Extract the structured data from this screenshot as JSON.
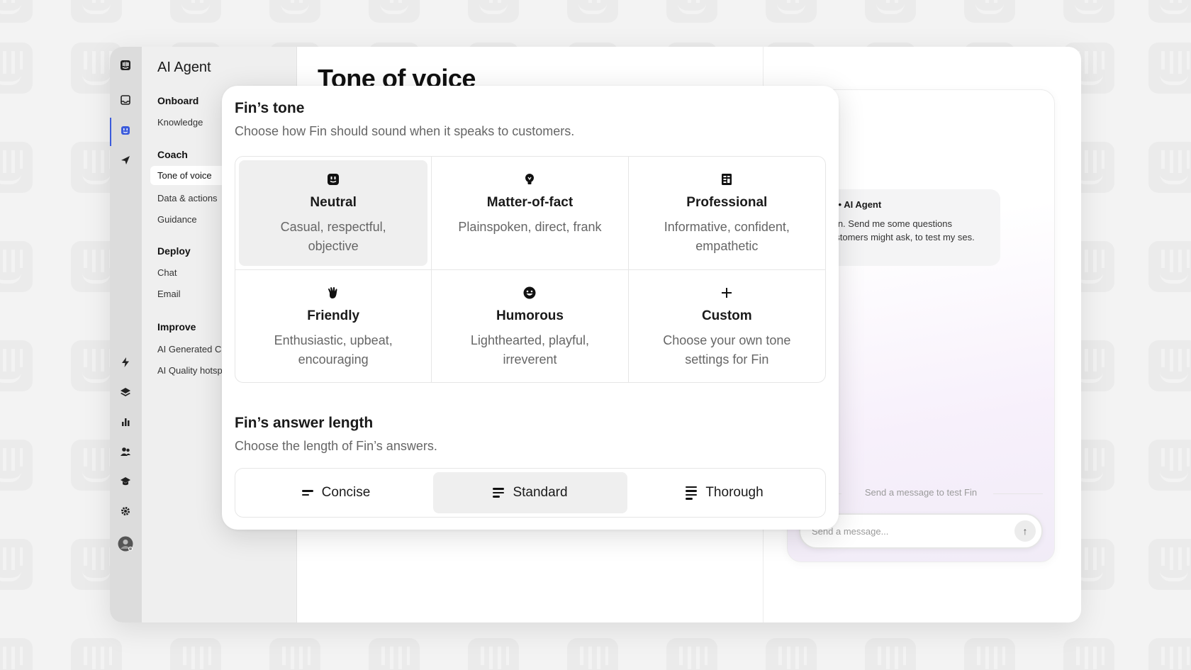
{
  "app": {
    "title": "AI Agent",
    "page_title": "Tone of voice"
  },
  "rail": {
    "icons": [
      "intercom-logo-icon",
      "inbox-icon",
      "ai-agent-icon",
      "send-icon",
      "bolt-icon",
      "layers-icon",
      "reports-icon",
      "contacts-icon",
      "academy-icon",
      "settings-icon",
      "avatar"
    ],
    "active_color": "#3b5bdb"
  },
  "nav": {
    "sections": [
      {
        "title": "Onboard",
        "items": [
          "Knowledge"
        ]
      },
      {
        "title": "Coach",
        "items": [
          "Tone of voice",
          "Data & actions",
          "Guidance"
        ]
      },
      {
        "title": "Deploy",
        "items": [
          "Chat",
          "Email"
        ]
      },
      {
        "title": "Improve",
        "items": [
          "AI Generated C:",
          "AI Quality hotsp"
        ]
      }
    ],
    "active_item": "Tone of voice"
  },
  "tone": {
    "heading": "Fin’s tone",
    "subheading": "Choose how Fin should sound when it speaks to customers.",
    "options": [
      {
        "name": "Neutral",
        "desc": "Casual, respectful, objective",
        "icon": "robot-face-icon",
        "selected": true
      },
      {
        "name": "Matter-of-fact",
        "desc": "Plainspoken, direct, frank",
        "icon": "lightbulb-icon",
        "selected": false
      },
      {
        "name": "Professional",
        "desc": "Informative, confident, empathetic",
        "icon": "building-icon",
        "selected": false
      },
      {
        "name": "Friendly",
        "desc": "Enthusiastic, upbeat, encouraging",
        "icon": "waving-hand-icon",
        "selected": false
      },
      {
        "name": "Humorous",
        "desc": "Lighthearted, playful, irreverent",
        "icon": "smiley-icon",
        "selected": false
      },
      {
        "name": "Custom",
        "desc": "Choose your own tone settings for Fin",
        "icon": "plus-icon",
        "selected": false
      }
    ]
  },
  "length": {
    "heading": "Fin’s answer length",
    "subheading": "Choose the length of Fin’s answers.",
    "options": [
      {
        "name": "Concise",
        "selected": false
      },
      {
        "name": "Standard",
        "selected": true
      },
      {
        "name": "Thorough",
        "selected": false
      }
    ]
  },
  "preview": {
    "sender": "n • AI Agent",
    "message": "Fin. Send me some questions ustomers might ask, to test my ses.",
    "hint": "Send a message to test Fin",
    "input_placeholder": "Send a message..."
  }
}
